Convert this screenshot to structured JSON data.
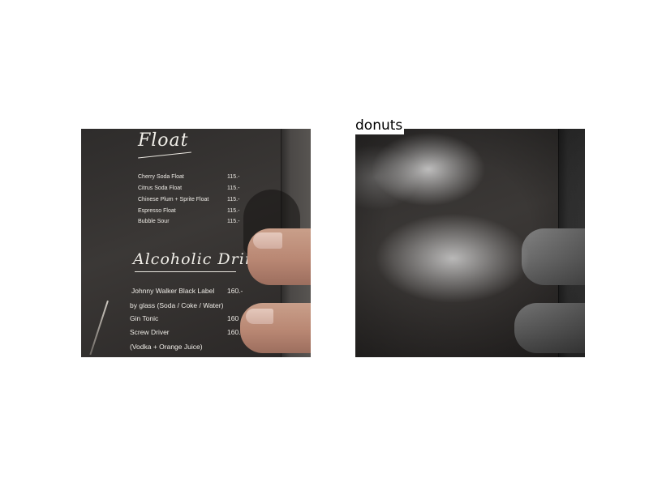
{
  "overlay_label": "donuts",
  "menu": {
    "float_heading": "Float",
    "float_items": [
      {
        "name": "Cherry Soda Float",
        "price": "115.-"
      },
      {
        "name": "Citrus Soda Float",
        "price": "115.-"
      },
      {
        "name": "Chinese Plum + Sprite Float",
        "price": "115.-"
      },
      {
        "name": "Espresso Float",
        "price": "115.-"
      },
      {
        "name": "Bubble Sour",
        "price": "115.-"
      }
    ],
    "alcohol_heading": "Alcoholic Drinks",
    "alcohol_items": [
      {
        "name": "Johnny Walker Black Label",
        "price": "160.-"
      },
      {
        "name": "by glass (Soda / Coke / Water)",
        "price": ""
      },
      {
        "name": "Gin Tonic",
        "price": "160"
      },
      {
        "name": "Screw Driver",
        "price": "160.-"
      },
      {
        "name": "(Vodka + Orange Juice)",
        "price": ""
      }
    ]
  }
}
